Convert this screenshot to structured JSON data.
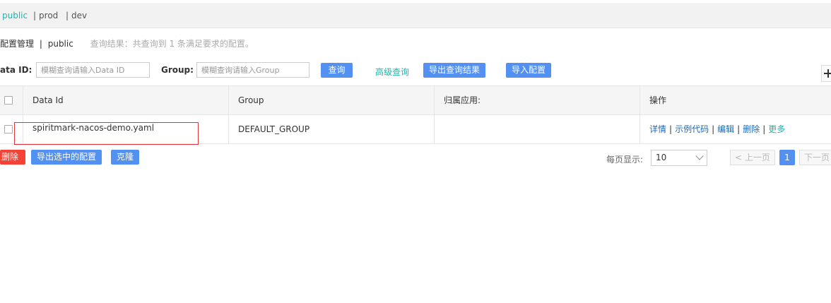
{
  "namespaces": [
    {
      "label": "public",
      "active": true
    },
    {
      "label": "prod",
      "active": false
    },
    {
      "label": "dev",
      "active": false
    }
  ],
  "namespace_separator": "|",
  "header": {
    "title": "配置管理",
    "separator": "|",
    "namespace": "public",
    "result_text": "查询结果：共查询到 1 条满足要求的配置。"
  },
  "search": {
    "data_id_label": "ata ID:",
    "data_id_placeholder": "模糊查询请输入Data ID",
    "group_label": "Group:",
    "group_placeholder": "模糊查询请输入Group",
    "query_button": "查询",
    "advanced_query": "高级查询",
    "export_results_button": "导出查询结果",
    "import_button": "导入配置"
  },
  "table": {
    "columns": [
      "Data Id",
      "Group",
      "归属应用:",
      "操作"
    ],
    "rows": [
      {
        "data_id": "spiritmark-nacos-demo.yaml",
        "group": "DEFAULT_GROUP",
        "app": "",
        "actions": [
          "详情",
          "示例代码",
          "编辑",
          "删除",
          "更多"
        ]
      }
    ],
    "action_separator": "|"
  },
  "bulk": {
    "delete_button": "删除",
    "export_selected_button": "导出选中的配置",
    "clone_button": "克隆"
  },
  "pagination": {
    "page_size_label": "每页显示:",
    "page_size": "10",
    "prev": "< 上一页",
    "current_page": "1",
    "next": "下一页"
  }
}
